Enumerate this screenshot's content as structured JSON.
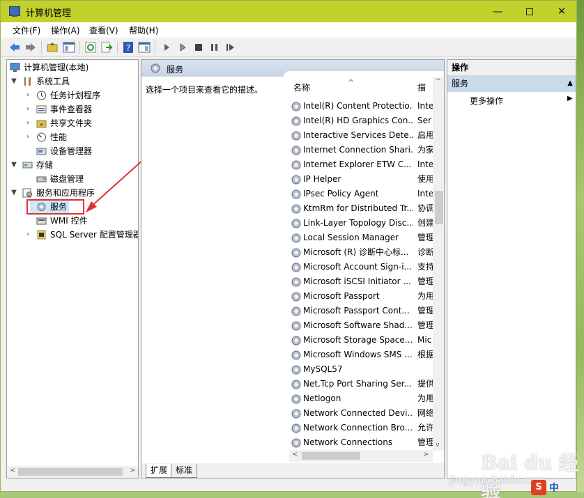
{
  "window": {
    "title": "计算机管理",
    "minimize": "—",
    "close": "✕"
  },
  "menu": [
    "文件(F)",
    "操作(A)",
    "查看(V)",
    "帮助(H)"
  ],
  "toolbar": {
    "icons": [
      "back-arrow-icon",
      "forward-arrow-icon",
      "up-folder-icon",
      "show-tree-icon",
      "refresh-icon",
      "export-icon",
      "help-icon",
      "properties-icon",
      "play-icon",
      "play-outline-icon",
      "stop-icon",
      "pause-icon",
      "restart-icon"
    ]
  },
  "tree": {
    "root": "计算机管理(本地)",
    "system_tools": "系统工具",
    "task_scheduler": "任务计划程序",
    "event_viewer": "事件查看器",
    "shared_folders": "共享文件夹",
    "performance": "性能",
    "device_manager": "设备管理器",
    "storage": "存储",
    "disk_management": "磁盘管理",
    "services_apps": "服务和应用程序",
    "services": "服务",
    "wmi": "WMI 控件",
    "sql": "SQL Server 配置管理器"
  },
  "center": {
    "header": "服务",
    "description": "选择一个项目来查看它的描述。",
    "col_name": "名称",
    "col_desc": "描述",
    "sort_caret": "^",
    "rows": [
      {
        "name": "Intel(R) Content Protectio...",
        "desc": "Inte"
      },
      {
        "name": "Intel(R) HD Graphics Con...",
        "desc": "Ser"
      },
      {
        "name": "Interactive Services Dete...",
        "desc": "启用"
      },
      {
        "name": "Internet Connection Shari...",
        "desc": "为家"
      },
      {
        "name": "Internet Explorer ETW C...",
        "desc": "Inte"
      },
      {
        "name": "IP Helper",
        "desc": "使用"
      },
      {
        "name": "IPsec Policy Agent",
        "desc": "Inte"
      },
      {
        "name": "KtmRm for Distributed Tr...",
        "desc": "协调"
      },
      {
        "name": "Link-Layer Topology Disc...",
        "desc": "创建"
      },
      {
        "name": "Local Session Manager",
        "desc": "管理"
      },
      {
        "name": "Microsoft (R) 诊断中心标...",
        "desc": "诊断"
      },
      {
        "name": "Microsoft Account Sign-i...",
        "desc": "支持"
      },
      {
        "name": "Microsoft iSCSI Initiator ...",
        "desc": "管理"
      },
      {
        "name": "Microsoft Passport",
        "desc": "为用"
      },
      {
        "name": "Microsoft Passport Cont...",
        "desc": "管理"
      },
      {
        "name": "Microsoft Software Shad...",
        "desc": "管理"
      },
      {
        "name": "Microsoft Storage Space...",
        "desc": "Mic"
      },
      {
        "name": "Microsoft Windows SMS ...",
        "desc": "根据"
      },
      {
        "name": "MySQL57",
        "desc": ""
      },
      {
        "name": "Net.Tcp Port Sharing Ser...",
        "desc": "提供"
      },
      {
        "name": "Netlogon",
        "desc": "为用"
      },
      {
        "name": "Network Connected Devi...",
        "desc": "网络"
      },
      {
        "name": "Network Connection Bro...",
        "desc": "允许"
      },
      {
        "name": "Network Connections",
        "desc": "管理"
      }
    ],
    "tab_extended": "扩展",
    "tab_standard": "标准"
  },
  "actions": {
    "title": "操作",
    "section": "服务",
    "more": "更多操作"
  },
  "watermark": {
    "brand": "Bai du 经验",
    "url": "jingyan.baidu.com"
  },
  "ime": {
    "s": "S",
    "lang": "中"
  },
  "colors": {
    "titlebar": "#c2d12c",
    "selection": "#cce8ff",
    "highlight_box": "#e03030",
    "section": "#c9daea"
  }
}
